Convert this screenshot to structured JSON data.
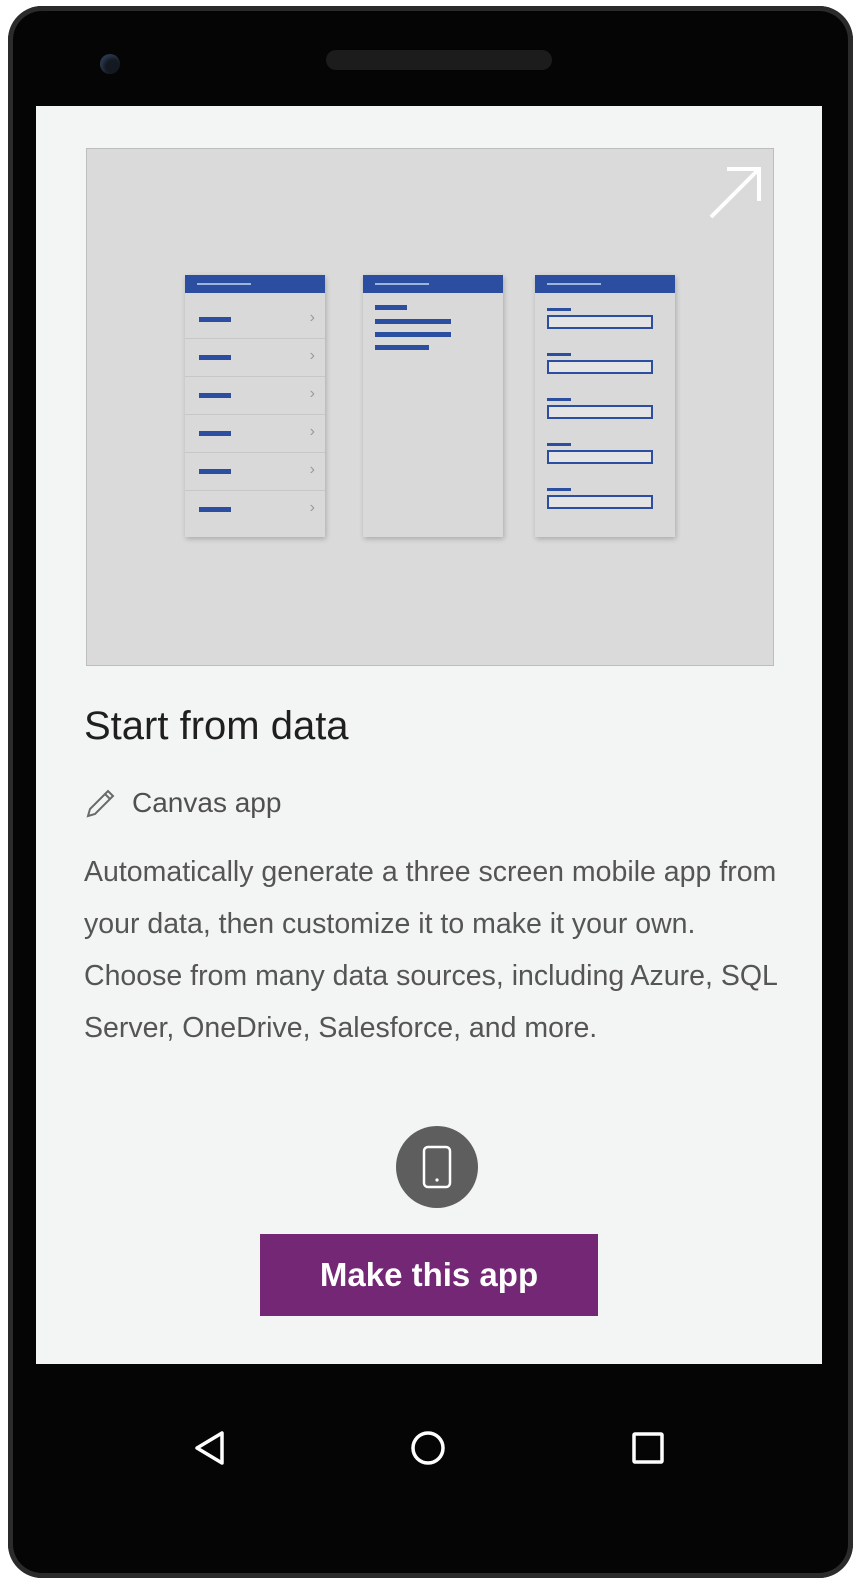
{
  "card": {
    "title": "Start from data",
    "type_icon": "pencil-icon",
    "type_label": "Canvas app",
    "description": "Automatically generate a three screen mobile app from your data, then customize it to make it your own. Choose from many data sources, including Azure, SQL Server, OneDrive, Salesforce, and more.",
    "device_icon": "phone-icon",
    "action_label": "Make this app"
  },
  "preview": {
    "expand_icon": "expand-arrow-icon",
    "list_screen_chevron": "›"
  },
  "colors": {
    "accent": "#742774",
    "screen_background": "#f3f4f4",
    "preview_background": "#dadada",
    "mock_header": "#2b4ea0"
  },
  "nav_bar": {
    "back_icon": "back-triangle-icon",
    "home_icon": "home-circle-icon",
    "recents_icon": "recents-square-icon"
  }
}
